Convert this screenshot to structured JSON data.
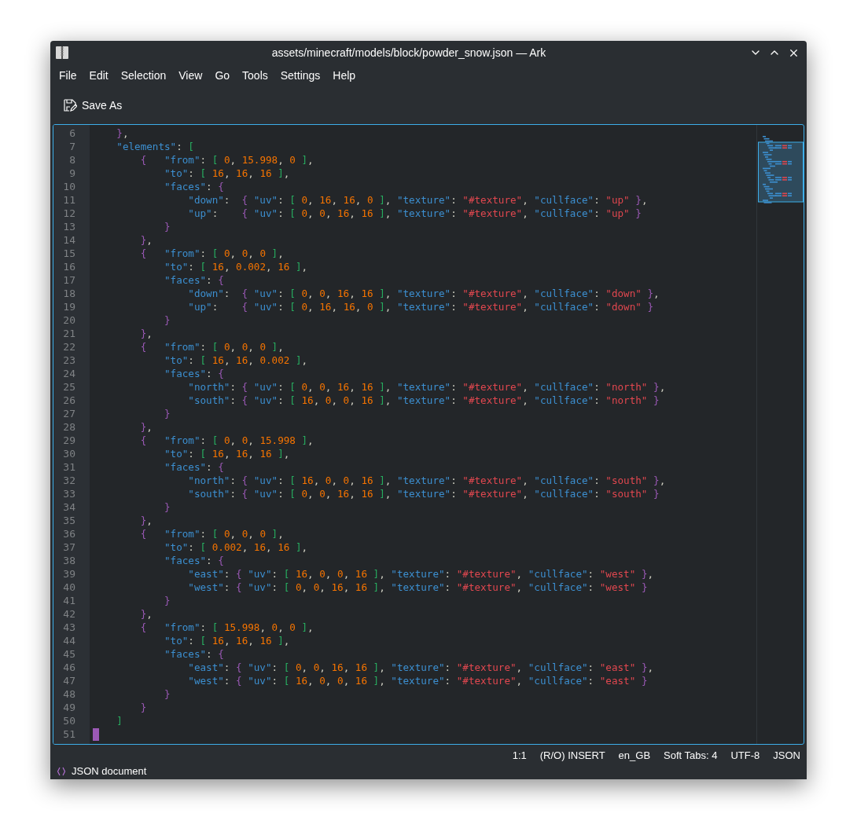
{
  "window": {
    "title": "assets/minecraft/models/block/powder_snow.json — Ark"
  },
  "menu": [
    "File",
    "Edit",
    "Selection",
    "View",
    "Go",
    "Tools",
    "Settings",
    "Help"
  ],
  "toolbar": {
    "save_as": "Save As"
  },
  "editor": {
    "lines": [
      {
        "number": "6",
        "text": "    },",
        "cursor": false
      },
      {
        "number": "7",
        "text": "    \"elements\": [",
        "cursor": false
      },
      {
        "number": "8",
        "text": "        {   \"from\": [ 0, 15.998, 0 ],",
        "cursor": false
      },
      {
        "number": "9",
        "text": "            \"to\": [ 16, 16, 16 ],",
        "cursor": false
      },
      {
        "number": "10",
        "text": "            \"faces\": {",
        "cursor": false
      },
      {
        "number": "11",
        "text": "                \"down\":  { \"uv\": [ 0, 16, 16, 0 ], \"texture\": \"#texture\", \"cullface\": \"up\" },",
        "cursor": false
      },
      {
        "number": "12",
        "text": "                \"up\":    { \"uv\": [ 0, 0, 16, 16 ], \"texture\": \"#texture\", \"cullface\": \"up\" }",
        "cursor": false
      },
      {
        "number": "13",
        "text": "            }",
        "cursor": false
      },
      {
        "number": "14",
        "text": "        },",
        "cursor": false
      },
      {
        "number": "15",
        "text": "        {   \"from\": [ 0, 0, 0 ],",
        "cursor": false
      },
      {
        "number": "16",
        "text": "            \"to\": [ 16, 0.002, 16 ],",
        "cursor": false
      },
      {
        "number": "17",
        "text": "            \"faces\": {",
        "cursor": false
      },
      {
        "number": "18",
        "text": "                \"down\":  { \"uv\": [ 0, 0, 16, 16 ], \"texture\": \"#texture\", \"cullface\": \"down\" },",
        "cursor": false
      },
      {
        "number": "19",
        "text": "                \"up\":    { \"uv\": [ 0, 16, 16, 0 ], \"texture\": \"#texture\", \"cullface\": \"down\" }",
        "cursor": false
      },
      {
        "number": "20",
        "text": "            }",
        "cursor": false
      },
      {
        "number": "21",
        "text": "        },",
        "cursor": false
      },
      {
        "number": "22",
        "text": "        {   \"from\": [ 0, 0, 0 ],",
        "cursor": false
      },
      {
        "number": "23",
        "text": "            \"to\": [ 16, 16, 0.002 ],",
        "cursor": false
      },
      {
        "number": "24",
        "text": "            \"faces\": {",
        "cursor": false
      },
      {
        "number": "25",
        "text": "                \"north\": { \"uv\": [ 0, 0, 16, 16 ], \"texture\": \"#texture\", \"cullface\": \"north\" },",
        "cursor": false
      },
      {
        "number": "26",
        "text": "                \"south\": { \"uv\": [ 16, 0, 0, 16 ], \"texture\": \"#texture\", \"cullface\": \"north\" }",
        "cursor": false
      },
      {
        "number": "27",
        "text": "            }",
        "cursor": false
      },
      {
        "number": "28",
        "text": "        },",
        "cursor": false
      },
      {
        "number": "29",
        "text": "        {   \"from\": [ 0, 0, 15.998 ],",
        "cursor": false
      },
      {
        "number": "30",
        "text": "            \"to\": [ 16, 16, 16 ],",
        "cursor": false
      },
      {
        "number": "31",
        "text": "            \"faces\": {",
        "cursor": false
      },
      {
        "number": "32",
        "text": "                \"north\": { \"uv\": [ 16, 0, 0, 16 ], \"texture\": \"#texture\", \"cullface\": \"south\" },",
        "cursor": false
      },
      {
        "number": "33",
        "text": "                \"south\": { \"uv\": [ 0, 0, 16, 16 ], \"texture\": \"#texture\", \"cullface\": \"south\" }",
        "cursor": false
      },
      {
        "number": "34",
        "text": "            }",
        "cursor": false
      },
      {
        "number": "35",
        "text": "        },",
        "cursor": false
      },
      {
        "number": "36",
        "text": "        {   \"from\": [ 0, 0, 0 ],",
        "cursor": false
      },
      {
        "number": "37",
        "text": "            \"to\": [ 0.002, 16, 16 ],",
        "cursor": false
      },
      {
        "number": "38",
        "text": "            \"faces\": {",
        "cursor": false
      },
      {
        "number": "39",
        "text": "                \"east\": { \"uv\": [ 16, 0, 0, 16 ], \"texture\": \"#texture\", \"cullface\": \"west\" },",
        "cursor": false
      },
      {
        "number": "40",
        "text": "                \"west\": { \"uv\": [ 0, 0, 16, 16 ], \"texture\": \"#texture\", \"cullface\": \"west\" }",
        "cursor": false
      },
      {
        "number": "41",
        "text": "            }",
        "cursor": false
      },
      {
        "number": "42",
        "text": "        },",
        "cursor": false
      },
      {
        "number": "43",
        "text": "        {   \"from\": [ 15.998, 0, 0 ],",
        "cursor": false
      },
      {
        "number": "44",
        "text": "            \"to\": [ 16, 16, 16 ],",
        "cursor": false
      },
      {
        "number": "45",
        "text": "            \"faces\": {",
        "cursor": false
      },
      {
        "number": "46",
        "text": "                \"east\": { \"uv\": [ 0, 0, 16, 16 ], \"texture\": \"#texture\", \"cullface\": \"east\" },",
        "cursor": false
      },
      {
        "number": "47",
        "text": "                \"west\": { \"uv\": [ 16, 0, 0, 16 ], \"texture\": \"#texture\", \"cullface\": \"east\" }",
        "cursor": false
      },
      {
        "number": "48",
        "text": "            }",
        "cursor": false
      },
      {
        "number": "49",
        "text": "        }",
        "cursor": false
      },
      {
        "number": "50",
        "text": "    ]",
        "cursor": false
      },
      {
        "number": "51",
        "cursor": true
      }
    ]
  },
  "status_bar": [
    "1:1",
    "(R/O) INSERT",
    "en_GB",
    "Soft Tabs: 4",
    "UTF-8",
    "JSON"
  ],
  "mode_bar": {
    "label": "JSON document"
  }
}
